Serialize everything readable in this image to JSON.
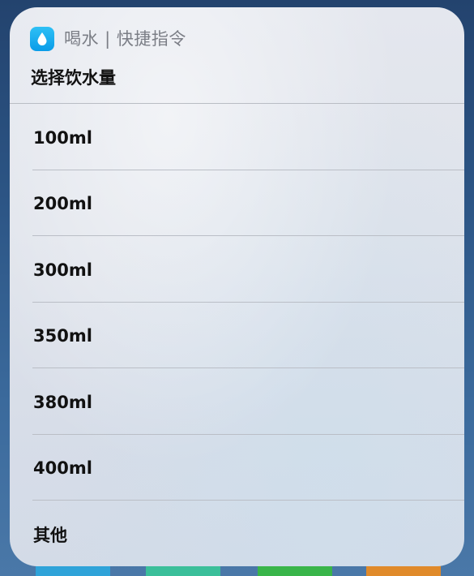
{
  "shortcut": {
    "app_name": "喝水 | 快捷指令",
    "app_icon": "water-drop-icon",
    "accent_color": "#11a8ee"
  },
  "prompt": "选择饮水量",
  "options": [
    {
      "label": "100ml"
    },
    {
      "label": "200ml"
    },
    {
      "label": "300ml"
    },
    {
      "label": "350ml"
    },
    {
      "label": "380ml"
    },
    {
      "label": "400ml"
    },
    {
      "label": "其他"
    }
  ]
}
